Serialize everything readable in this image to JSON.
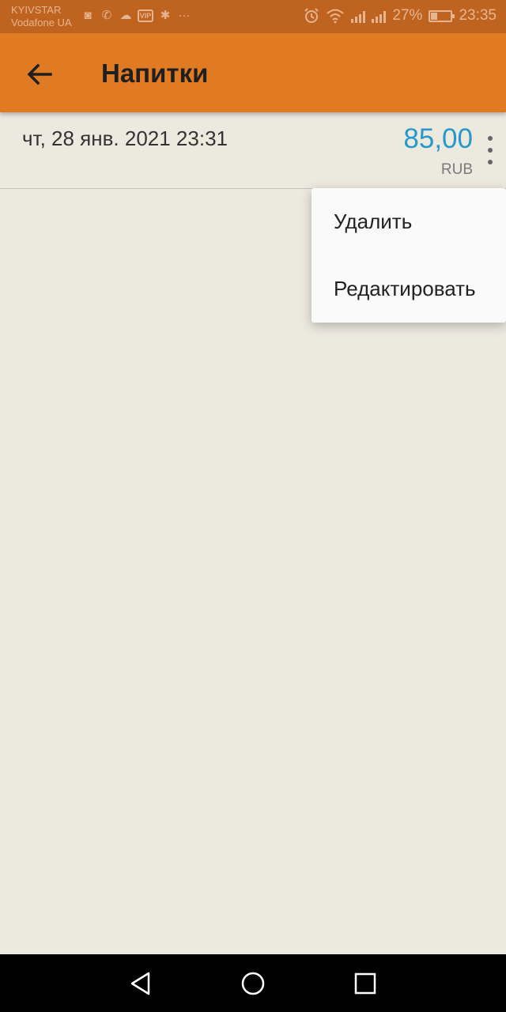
{
  "status_bar": {
    "carrier_1": "KYIVSTAR",
    "carrier_2": "Vodafone UA",
    "battery_percent": "27%",
    "time": "23:35",
    "icons": [
      "notification-icon",
      "viber-icon",
      "cloud-icon",
      "vip-icon",
      "slack-icon",
      "more-icon",
      "alarm-icon",
      "wifi-icon",
      "signal-icon",
      "signal-icon",
      "battery-icon"
    ]
  },
  "app_bar": {
    "back_icon": "arrow-left-icon",
    "title": "Напитки",
    "background": "#e07b24"
  },
  "entry": {
    "date": "чт, 28 янв. 2021 23:31",
    "amount": "85,00",
    "currency": "RUB",
    "amount_color": "#2698cc",
    "menu_icon": "more-vert-icon"
  },
  "popup_menu": {
    "items": [
      {
        "label": "Удалить"
      },
      {
        "label": "Редактировать"
      }
    ]
  },
  "nav_bar": {
    "icons": [
      "back-triangle-icon",
      "home-circle-icon",
      "recents-square-icon"
    ]
  }
}
